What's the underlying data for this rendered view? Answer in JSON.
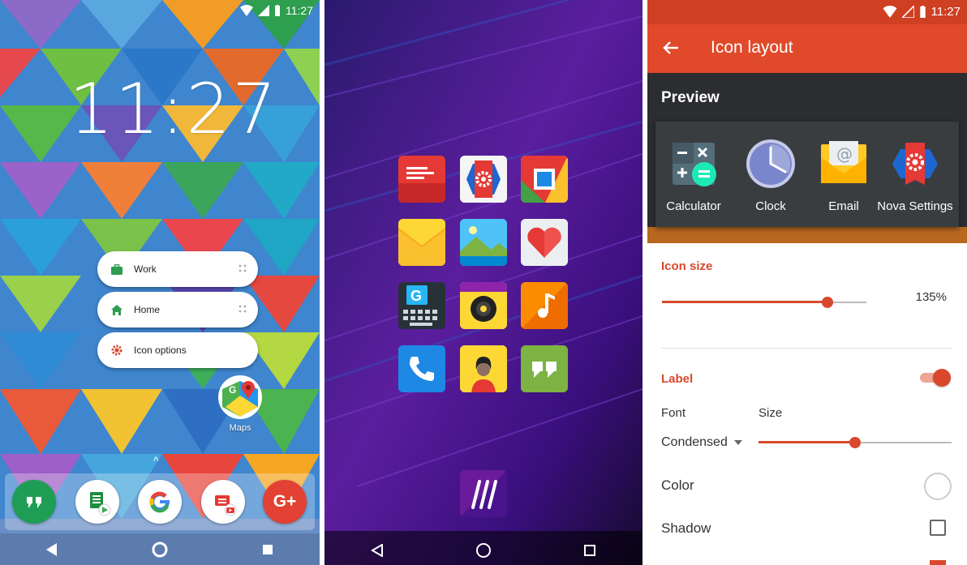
{
  "home": {
    "status_time": "11:27",
    "clock": "11:27",
    "shortcuts": [
      {
        "label": "Work"
      },
      {
        "label": "Home"
      },
      {
        "label": "Icon options"
      }
    ],
    "maps_label": "Maps"
  },
  "settings": {
    "status_time": "11:27",
    "title": "Icon layout",
    "preview_title": "Preview",
    "preview_apps": [
      "Calculator",
      "Clock",
      "Email",
      "Nova Settings"
    ],
    "icon_size_label": "Icon size",
    "icon_size_value": "135%",
    "icon_size_level": 0.81,
    "label_section": "Label",
    "label_toggle_on": true,
    "font_label": "Font",
    "size_label": "Size",
    "font_value": "Condensed",
    "label_size_level": 0.5,
    "color_label": "Color",
    "shadow_label": "Shadow"
  },
  "colors": {
    "accent": "#d9482c",
    "appbar": "#e0492a"
  }
}
